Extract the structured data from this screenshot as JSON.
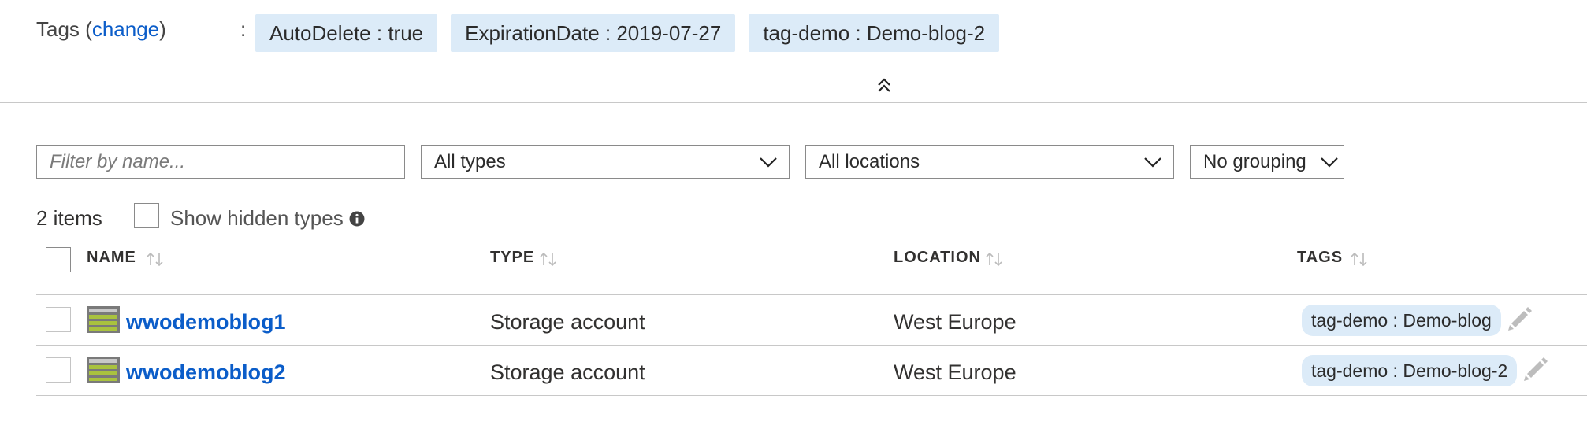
{
  "tags_header": {
    "label": "Tags",
    "open_paren": "(",
    "change_link": "change",
    "close_paren": ")",
    "colon": ":",
    "chips": [
      "AutoDelete : true",
      "ExpirationDate : 2019-07-27",
      "tag-demo : Demo-blog-2"
    ]
  },
  "filters": {
    "name_placeholder": "Filter by name...",
    "type_value": "All types",
    "location_value": "All locations",
    "grouping_value": "No grouping"
  },
  "summary": {
    "count": "2 items",
    "show_hidden_label": "Show hidden types"
  },
  "table": {
    "columns": [
      "NAME",
      "TYPE",
      "LOCATION",
      "TAGS"
    ],
    "rows": [
      {
        "name": "wwodemoblog1",
        "type": "Storage account",
        "location": "West Europe",
        "tag": "tag-demo : Demo-blog"
      },
      {
        "name": "wwodemoblog2",
        "type": "Storage account",
        "location": "West Europe",
        "tag": "tag-demo : Demo-blog-2"
      }
    ]
  },
  "icons": {
    "collapse": "double-chevron-up-icon",
    "dropdown": "chevron-down-icon",
    "info": "info-icon",
    "sort": "sort-icon",
    "resource": "storage-account-icon",
    "edit": "pencil-icon"
  },
  "colors": {
    "link": "#0b5dc9",
    "chip_bg": "#dcebf8",
    "storage_icon_green": "#a9c23f",
    "storage_icon_gray": "#7a7a7a"
  }
}
